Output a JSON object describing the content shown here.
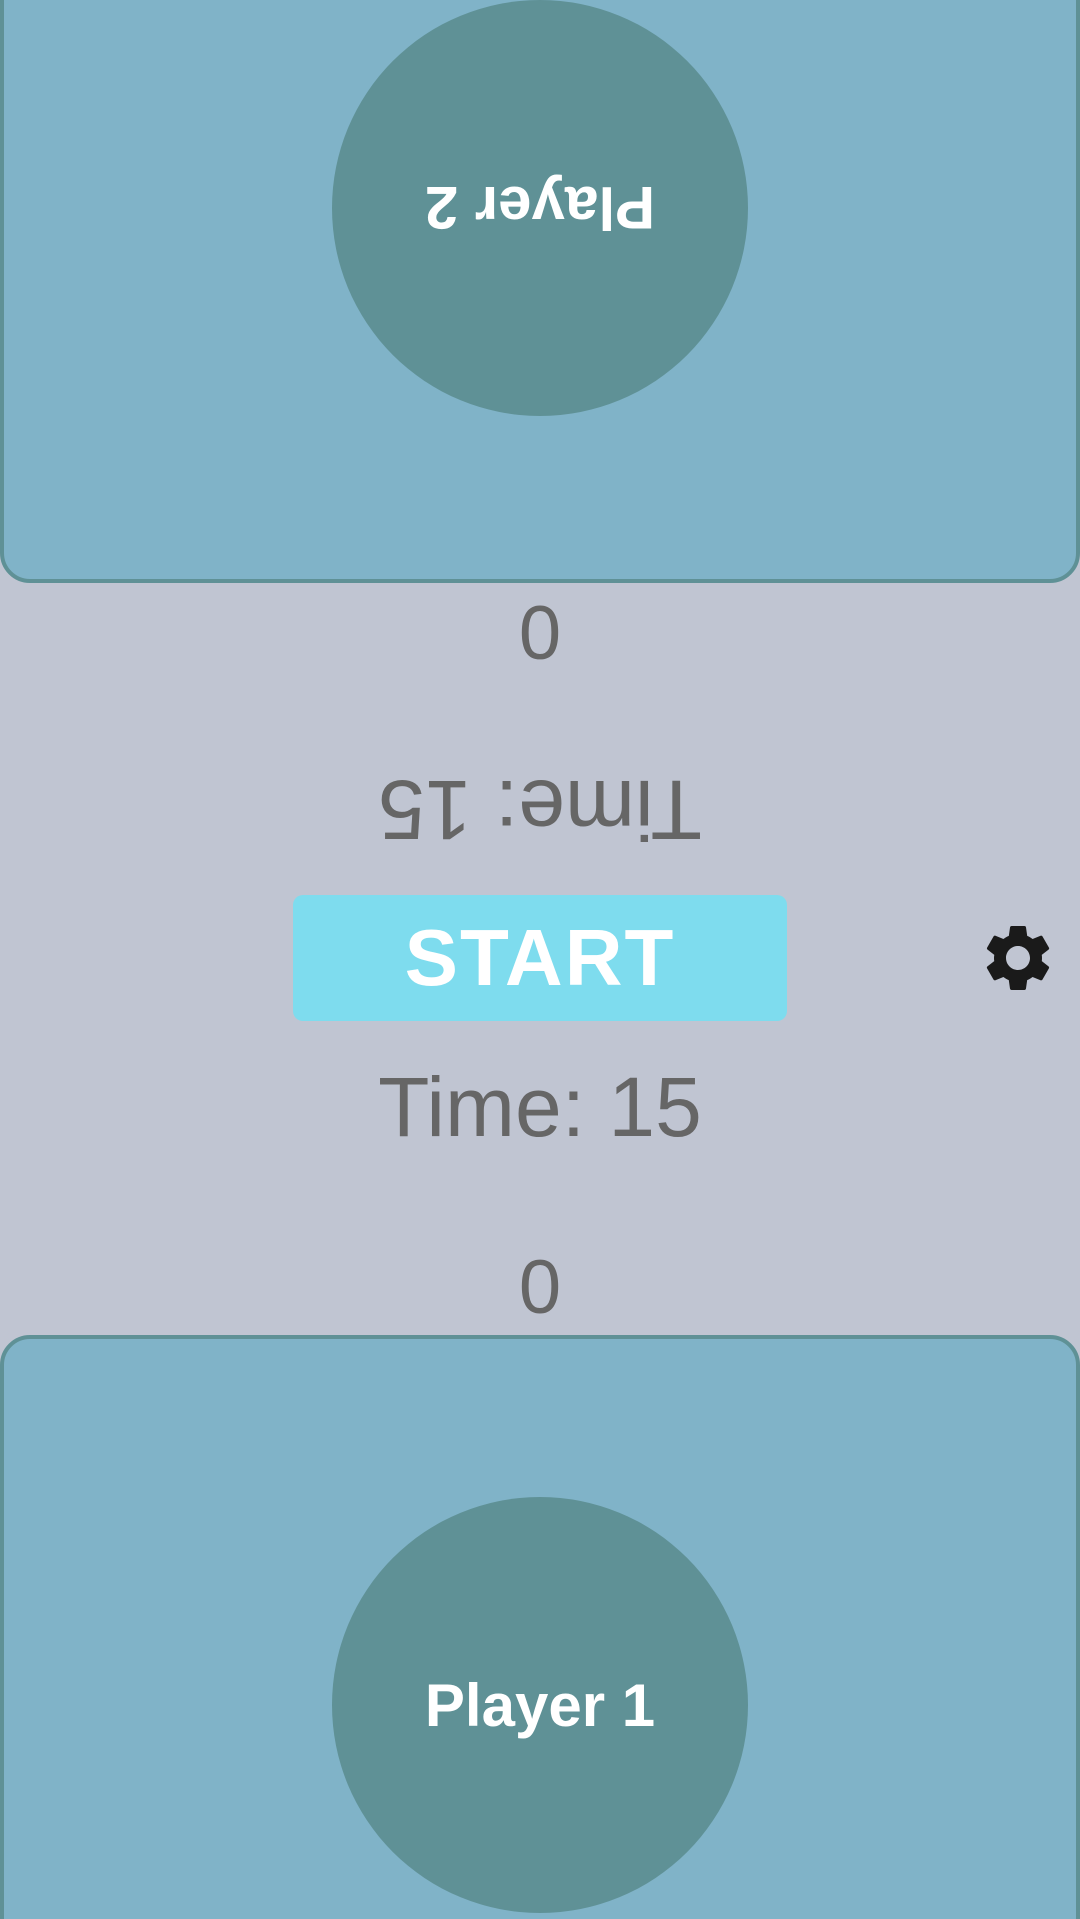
{
  "players": {
    "top": {
      "label": "Player 2",
      "score": "0",
      "time_text": "Time: 15"
    },
    "bottom": {
      "label": "Player 1",
      "score": "0",
      "time_text": "Time: 15"
    }
  },
  "controls": {
    "start_label": "START",
    "settings_icon": "gear-icon"
  },
  "colors": {
    "background": "#c0c5d2",
    "panel": "#80b3c8",
    "panel_border": "#5f9196",
    "circle": "#5f9196",
    "start_button": "#7edcee",
    "text": "#666666"
  }
}
